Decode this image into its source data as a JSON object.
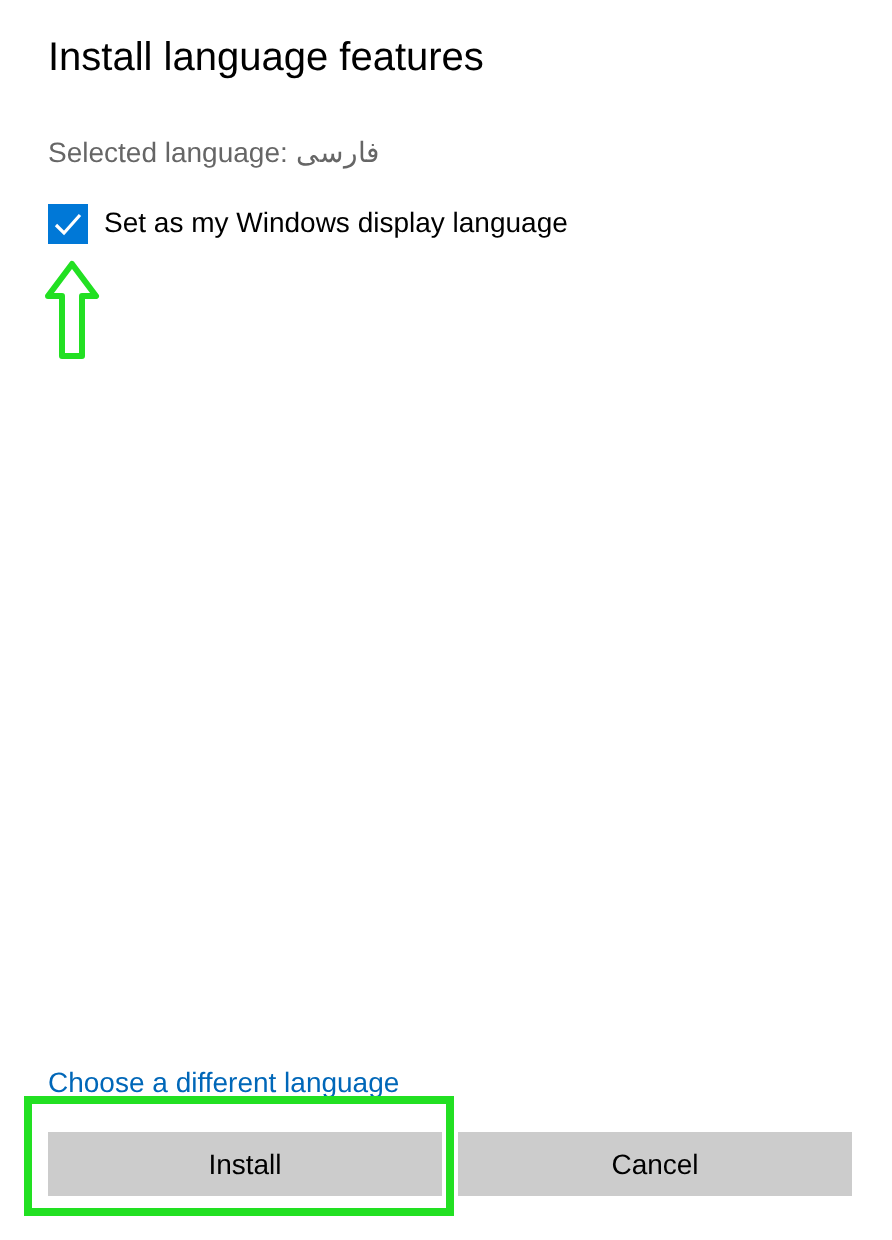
{
  "title": "Install language features",
  "selected_language": {
    "label": "Selected language:",
    "value": "فارسی"
  },
  "options": [
    {
      "label": "Set as my Windows display language",
      "checked": true
    }
  ],
  "link": "Choose a different language",
  "buttons": [
    {
      "label": "Install",
      "highlighted": true
    },
    {
      "label": "Cancel",
      "highlighted": false
    }
  ],
  "annotation": {
    "kind": "arrow"
  }
}
